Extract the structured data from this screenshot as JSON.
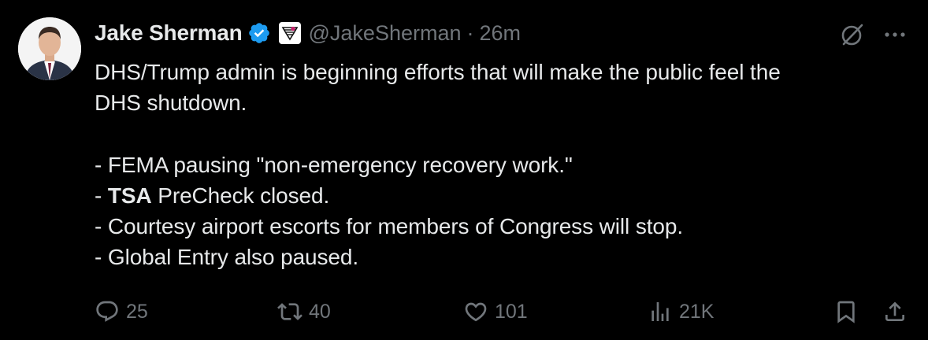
{
  "author": {
    "name": "Jake Sherman",
    "handle": "@JakeSherman",
    "separator": "·",
    "time": "26m",
    "verified": true,
    "verified_color": "#1d9bf0"
  },
  "tweet": {
    "lines": [
      "DHS/Trump admin is beginning efforts that will make the public feel the",
      "DHS shutdown.",
      "",
      "- FEMA pausing \"non-emergency recovery work.\"",
      "- ",
      "TSA",
      " PreCheck closed.",
      "- Courtesy airport escorts for members of Congress will stop.",
      "- Global Entry also paused."
    ]
  },
  "actions": {
    "replies": "25",
    "reposts": "40",
    "likes": "101",
    "views": "21K"
  },
  "icons": {
    "reply": "reply-icon",
    "repost": "repost-icon",
    "like": "heart-icon",
    "views": "views-icon",
    "bookmark": "bookmark-icon",
    "share": "share-icon",
    "grok": "grok-icon",
    "more": "more-icon",
    "verified": "verified-badge-icon",
    "affiliate": "affiliate-badge-icon"
  },
  "colors": {
    "background": "#000000",
    "text": "#e7e9ea",
    "secondary": "#71767b"
  }
}
